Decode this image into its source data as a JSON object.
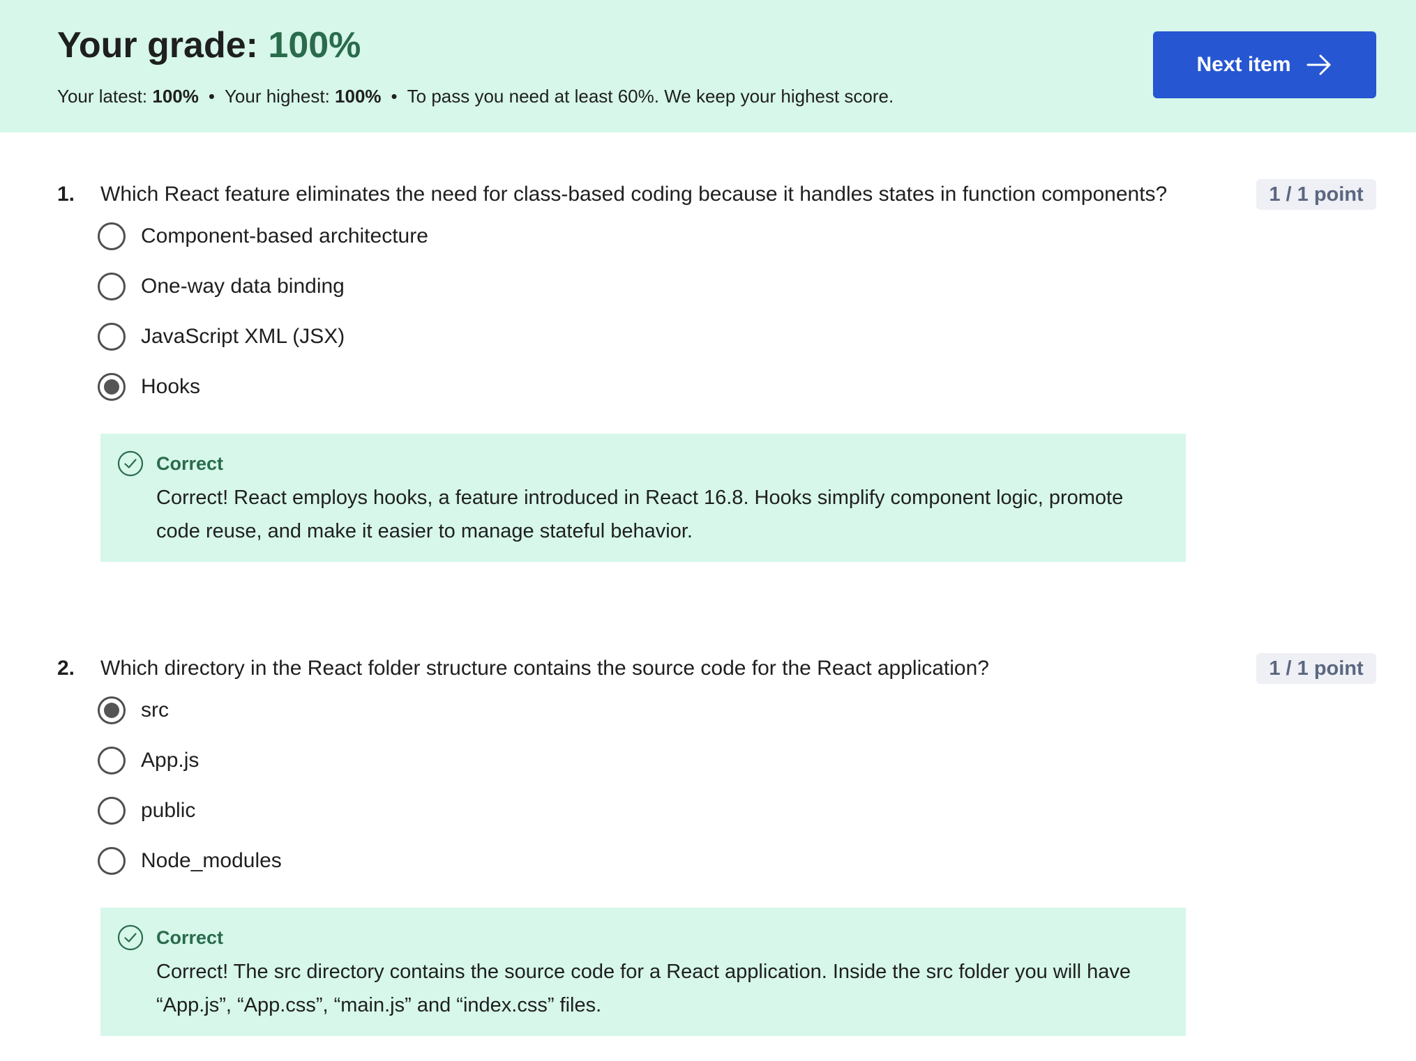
{
  "header": {
    "grade_label": "Your grade:",
    "grade_value": "100%",
    "latest_label": "Your latest:",
    "latest_value": "100%",
    "highest_label": "Your highest:",
    "highest_value": "100%",
    "separator": "•",
    "pass_note": "To pass you need at least 60%. We keep your highest score.",
    "next_button_label": "Next item",
    "next_button_icon": "arrow-right-icon"
  },
  "colors": {
    "header_bg": "#d6f7ea",
    "grade_green": "#2a6b4c",
    "button_blue": "#2656d1",
    "points_badge_bg": "#eef0f5",
    "feedback_bg": "#d6f7ea"
  },
  "questions": [
    {
      "number": "1.",
      "text": "Which React feature eliminates the need for class-based coding because it handles states in function components?",
      "points": "1 / 1 point",
      "options": [
        {
          "label": "Component-based architecture",
          "selected": false
        },
        {
          "label": "One-way data binding",
          "selected": false
        },
        {
          "label": "JavaScript XML (JSX)",
          "selected": false
        },
        {
          "label": "Hooks",
          "selected": true
        }
      ],
      "feedback": {
        "icon": "check-circle-icon",
        "title": "Correct",
        "text": "Correct! React employs hooks, a feature introduced in React 16.8. Hooks simplify component logic, promote code reuse, and make it easier to manage stateful behavior."
      }
    },
    {
      "number": "2.",
      "text": "Which directory in the React folder structure contains the source code for the React application?",
      "points": "1 / 1 point",
      "options": [
        {
          "label": "src",
          "selected": true
        },
        {
          "label": "App.js",
          "selected": false
        },
        {
          "label": "public",
          "selected": false
        },
        {
          "label": "Node_modules",
          "selected": false
        }
      ],
      "feedback": {
        "icon": "check-circle-icon",
        "title": "Correct",
        "text": "Correct! The src directory contains the source code for a React application. Inside the src folder you will have “App.js”, “App.css”, “main.js” and “index.css” files."
      }
    }
  ]
}
